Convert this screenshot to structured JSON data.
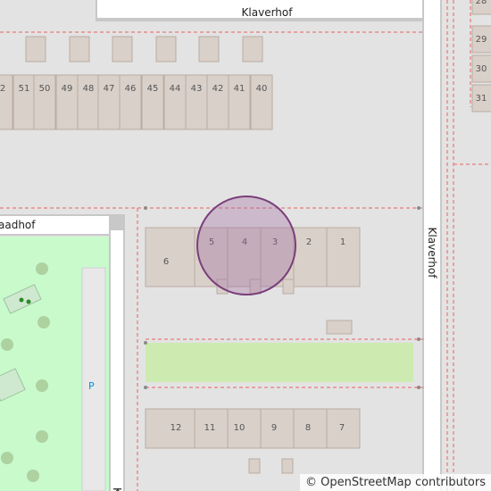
{
  "streets": {
    "top": "Klaverhof",
    "right": "Klaverhof",
    "left_block": "aadhof",
    "bottom_left": "K"
  },
  "house_numbers": {
    "top_row": [
      "2",
      "51",
      "50",
      "49",
      "48",
      "47",
      "46",
      "45",
      "44",
      "43",
      "42",
      "41",
      "40"
    ],
    "right_edge": [
      "28",
      "29",
      "30",
      "31"
    ],
    "middle_row": [
      "6",
      "5",
      "4",
      "3",
      "2",
      "1"
    ],
    "bottom_row": [
      "12",
      "11",
      "10",
      "9",
      "8",
      "7"
    ]
  },
  "park": {
    "parking_label": "P"
  },
  "attribution": {
    "symbol": "©",
    "text": "OpenStreetMap contributors"
  },
  "colors": {
    "background": "#e3e3e3",
    "building": "#d9d0c9",
    "building_edge": "#b9aca3",
    "road": "#ffffff",
    "road_edge": "#c8c8c8",
    "boundary": "#e88d8d",
    "grass": "#cdebb0",
    "park": "#c8facc",
    "tree": "#aed1a0",
    "marker_fill": "#a06ba0",
    "marker_stroke": "#7a3f7a"
  }
}
